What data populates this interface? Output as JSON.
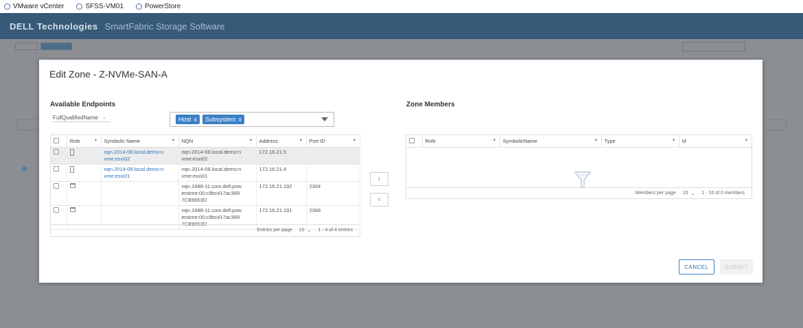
{
  "bookmarks": [
    {
      "label": "VMware vCenter",
      "icon": "globe-icon"
    },
    {
      "label": "SFSS-VM01",
      "icon": "globe-icon"
    },
    {
      "label": "PowerStore",
      "icon": "globe-icon"
    }
  ],
  "app": {
    "brand": "DELL Technologies",
    "product": "SmartFabric Storage Software"
  },
  "dialog": {
    "title": "Edit Zone - Z-NVMe-SAN-A",
    "available_title": "Available Endpoints",
    "members_title": "Zone Members",
    "filter_field": "FullQualifiedName",
    "tags": [
      {
        "label": "Host",
        "remove": "x"
      },
      {
        "label": "Subsystem",
        "remove": "x"
      }
    ],
    "endpoints": {
      "columns": [
        "Role",
        "Symbolic Name",
        "NQN",
        "Address",
        "Port ID"
      ],
      "rows": [
        {
          "symbolic_name": "nqn.2014-08.local.demo:n vme:esxi02",
          "nqn": "nqn.2014-08.local.demo:n vme:esxi02",
          "address": "172.16.21.5",
          "port_id": "",
          "role_icon": "host-icon"
        },
        {
          "symbolic_name": "nqn.2014-08.local.demo:n vme:esxi01",
          "nqn": "nqn.2014-08.local.demo:n vme:esxi01",
          "address": "172.16.21.4",
          "port_id": "",
          "role_icon": "host-icon"
        },
        {
          "symbolic_name": "",
          "nqn": "nqn.1988-11.com.dell:pow erstore:00:c9bc417ac389 7CB9653D",
          "address": "172.16.21.192",
          "port_id": "2304",
          "role_icon": "storage-icon"
        },
        {
          "symbolic_name": "",
          "nqn": "nqn.1988-11.com.dell:pow erstore:00:c9bc417ac389 7CB9653D",
          "address": "172.16.21.191",
          "port_id": "2368",
          "role_icon": "storage-icon"
        }
      ],
      "per_page_label": "Entries per page",
      "per_page": "10",
      "range": "1 - 4 of 4 entries"
    },
    "members": {
      "columns": [
        "Role",
        "SymbolicName",
        "Type",
        "Id"
      ],
      "per_page_label": "Members per page",
      "per_page": "10",
      "range": "1 - 10 of 0 members"
    },
    "move_right": "›",
    "move_left": "‹",
    "cancel_label": "CANCEL",
    "submit_label": "SUBMIT"
  }
}
